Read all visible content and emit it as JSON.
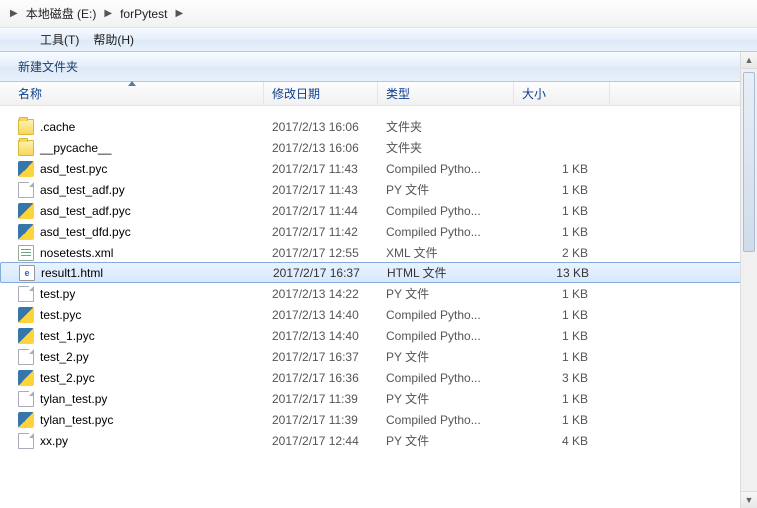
{
  "breadcrumb": {
    "items": [
      "本地磁盘 (E:)",
      "forPytest"
    ]
  },
  "menubar": {
    "tools": "工具(T)",
    "help": "帮助(H)"
  },
  "toolbar": {
    "new_folder": "新建文件夹"
  },
  "columns": {
    "name": "名称",
    "date": "修改日期",
    "type": "类型",
    "size": "大小"
  },
  "files": [
    {
      "icon": "folder",
      "name": ".cache",
      "date": "2017/2/13 16:06",
      "type": "文件夹",
      "size": ""
    },
    {
      "icon": "folder",
      "name": "__pycache__",
      "date": "2017/2/13 16:06",
      "type": "文件夹",
      "size": ""
    },
    {
      "icon": "py",
      "name": "asd_test.pyc",
      "date": "2017/2/17 11:43",
      "type": "Compiled Pytho...",
      "size": "1 KB"
    },
    {
      "icon": "file",
      "name": "asd_test_adf.py",
      "date": "2017/2/17 11:43",
      "type": "PY 文件",
      "size": "1 KB"
    },
    {
      "icon": "py",
      "name": "asd_test_adf.pyc",
      "date": "2017/2/17 11:44",
      "type": "Compiled Pytho...",
      "size": "1 KB"
    },
    {
      "icon": "py",
      "name": "asd_test_dfd.pyc",
      "date": "2017/2/17 11:42",
      "type": "Compiled Pytho...",
      "size": "1 KB"
    },
    {
      "icon": "xml",
      "name": "nosetests.xml",
      "date": "2017/2/17 12:55",
      "type": "XML 文件",
      "size": "2 KB"
    },
    {
      "icon": "html",
      "name": "result1.html",
      "date": "2017/2/17 16:37",
      "type": "HTML 文件",
      "size": "13 KB",
      "selected": true
    },
    {
      "icon": "file",
      "name": "test.py",
      "date": "2017/2/13 14:22",
      "type": "PY 文件",
      "size": "1 KB"
    },
    {
      "icon": "py",
      "name": "test.pyc",
      "date": "2017/2/13 14:40",
      "type": "Compiled Pytho...",
      "size": "1 KB"
    },
    {
      "icon": "py",
      "name": "test_1.pyc",
      "date": "2017/2/13 14:40",
      "type": "Compiled Pytho...",
      "size": "1 KB"
    },
    {
      "icon": "file",
      "name": "test_2.py",
      "date": "2017/2/17 16:37",
      "type": "PY 文件",
      "size": "1 KB"
    },
    {
      "icon": "py",
      "name": "test_2.pyc",
      "date": "2017/2/17 16:36",
      "type": "Compiled Pytho...",
      "size": "3 KB"
    },
    {
      "icon": "file",
      "name": "tylan_test.py",
      "date": "2017/2/17 11:39",
      "type": "PY 文件",
      "size": "1 KB"
    },
    {
      "icon": "py",
      "name": "tylan_test.pyc",
      "date": "2017/2/17 11:39",
      "type": "Compiled Pytho...",
      "size": "1 KB"
    },
    {
      "icon": "file",
      "name": "xx.py",
      "date": "2017/2/17 12:44",
      "type": "PY 文件",
      "size": "4 KB"
    }
  ]
}
